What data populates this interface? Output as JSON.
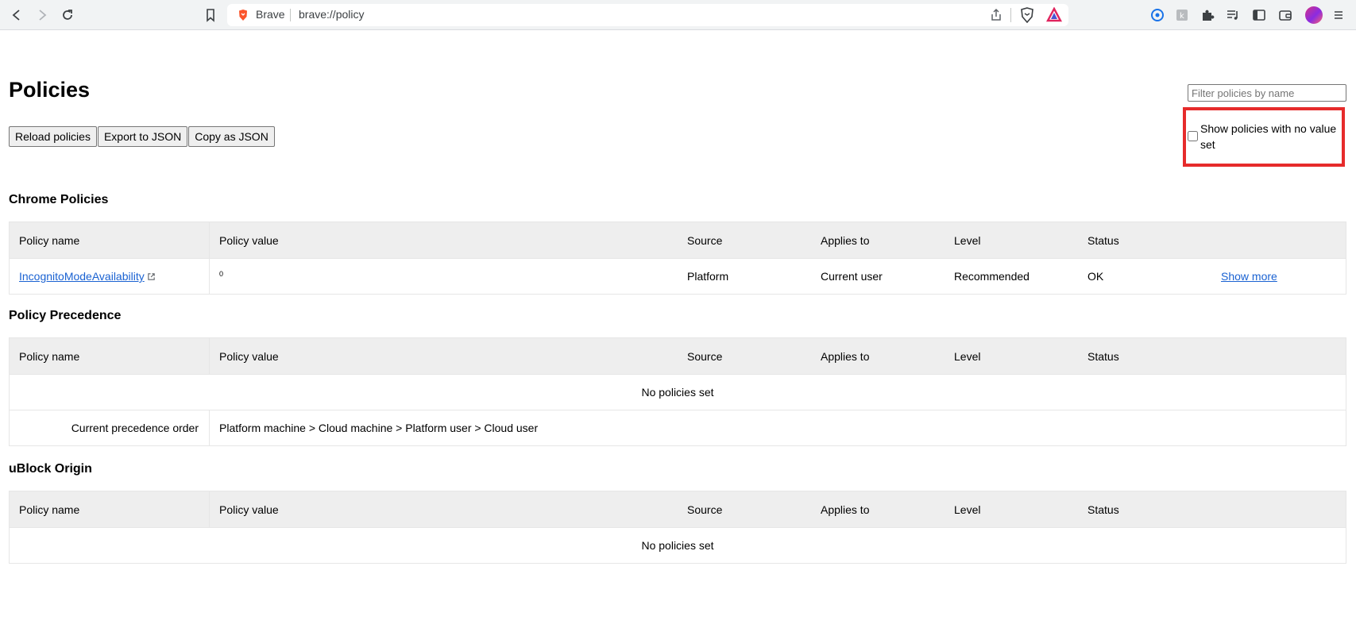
{
  "browser": {
    "brand": "Brave",
    "url": "brave://policy",
    "icons": {
      "back": "back-arrow-icon",
      "forward": "forward-arrow-icon",
      "reload": "reload-icon",
      "bookmark": "bookmark-icon",
      "share": "share-icon",
      "brave_shields": "brave-shields-icon",
      "rewards": "brave-rewards-icon",
      "extensions": [
        "vpn-extension-icon",
        "extension-icon",
        "puzzle-icon",
        "reading-list-icon",
        "sidebar-icon",
        "wallet-icon"
      ],
      "menu": "menu-icon"
    }
  },
  "page": {
    "title": "Policies",
    "buttons": {
      "reload": "Reload policies",
      "export": "Export to JSON",
      "copy": "Copy as JSON"
    },
    "filter_placeholder": "Filter policies by name",
    "show_no_value_label": "Show policies with no value set",
    "show_no_value_checked": false,
    "highlight_color": "#e62b2b",
    "link_color": "#1a62d2"
  },
  "columns": {
    "name": "Policy name",
    "value": "Policy value",
    "source": "Source",
    "applies": "Applies to",
    "level": "Level",
    "status": "Status"
  },
  "chrome_policies": {
    "title": "Chrome Policies",
    "rows": [
      {
        "name": "IncognitoModeAvailability",
        "value": "0",
        "source": "Platform",
        "applies": "Current user",
        "level": "Recommended",
        "status": "OK",
        "more": "Show more"
      }
    ]
  },
  "policy_precedence": {
    "title": "Policy Precedence",
    "empty": "No policies set",
    "order_label": "Current precedence order",
    "order_value": "Platform machine > Cloud machine > Platform user > Cloud user"
  },
  "ublock": {
    "title": "uBlock Origin",
    "empty": "No policies set"
  }
}
